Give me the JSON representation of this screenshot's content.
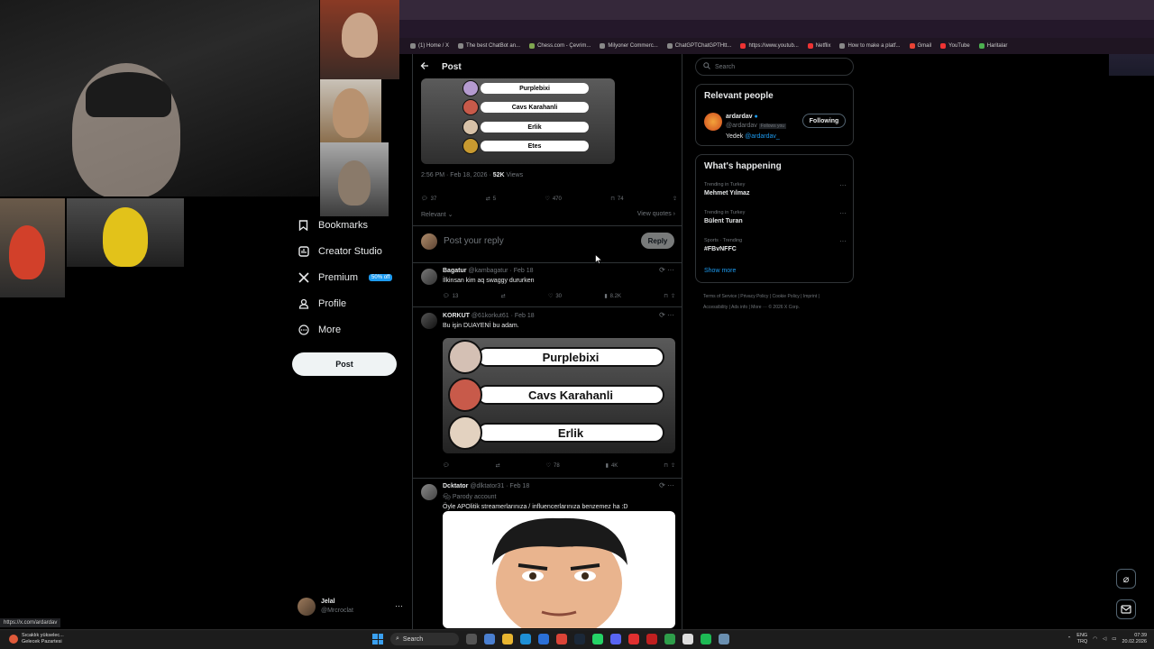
{
  "bookmarks": [
    "(1) Home / X",
    "The best ChatBot an...",
    "Chess.com - Çevrim...",
    "Milyoner Commerc...",
    "ChatGPTChatGPTHtt...",
    "https://www.youtub...",
    "Netflix",
    "How to make a platf...",
    "Gmail",
    "YouTube",
    "Haritalar"
  ],
  "nav": {
    "bookmarks": "Bookmarks",
    "creator_studio": "Creator Studio",
    "premium": "Premium",
    "premium_badge": "50% off",
    "profile": "Profile",
    "more": "More",
    "post": "Post"
  },
  "account": {
    "name": "Jelal",
    "handle": "@Mrcroclat"
  },
  "post": {
    "header": "Post",
    "image_names": [
      "Purplebixi",
      "Cavs Karahanli",
      "Erlik",
      "Etes"
    ],
    "time": "2:56 PM · Feb 18, 2026 · ",
    "views": "52K",
    "views_label": " Views",
    "stats": {
      "replies": "37",
      "reposts": "5",
      "likes": "470",
      "bookmarks": "74"
    },
    "sort": "Relevant ⌄",
    "view_quotes": "View quotes ›"
  },
  "reply_box": {
    "placeholder": "Post your reply",
    "button": "Reply"
  },
  "replies": [
    {
      "name": "Bagatur",
      "handle": "@kambagatur · Feb 18",
      "text": "İlkinsan kim aq swaggy dururken",
      "replies": "13",
      "likes": "30",
      "views": "8.2K"
    },
    {
      "name": "KORKUT",
      "handle": "@61korkut61 · Feb 18",
      "text": "Bu işin DUAYENİ bu adam.",
      "image_names": [
        "Purplebixi",
        "Cavs Karahanli",
        "Erlik"
      ],
      "likes": "78",
      "views": "4K"
    },
    {
      "name": "Dcktator",
      "handle": "@dlktator31 · Feb 18",
      "badge": "Parody account",
      "text": "Öyle APOlitik streamerlarınıza / influencerlarınıza benzemez ha :D"
    }
  ],
  "right": {
    "search_placeholder": "Search",
    "relevant_title": "Relevant people",
    "person": {
      "name": "ardardav",
      "handle": "@ardardav",
      "follows_you": "Follows you",
      "bio_prefix": "Yedek ",
      "bio_link": "@ardardav_",
      "button": "Following"
    },
    "happening_title": "What's happening",
    "trends": [
      {
        "context": "Trending in Turkey",
        "name": "Mehmet Yılmaz"
      },
      {
        "context": "Trending in Turkey",
        "name": "Bülent Turan"
      },
      {
        "context": "Sports · Trending",
        "name": "#FBvNFFC"
      }
    ],
    "show_more": "Show more",
    "footer": "Terms of Service  |  Privacy Policy  |  Cookie Policy  |  Imprint  |  Accessibility  |  Ads info  |  More ···  © 2026 X Corp."
  },
  "statusbar": {
    "url": "https://x.com/ardardav"
  },
  "taskbar": {
    "weather_line1": "Sıcaklık yükselec...",
    "weather_line2": "Gelecek Pazartesi",
    "search": "Search",
    "lang1": "ENG",
    "lang2": "TRQ",
    "time": "07:39",
    "date": "20.02.2026"
  }
}
